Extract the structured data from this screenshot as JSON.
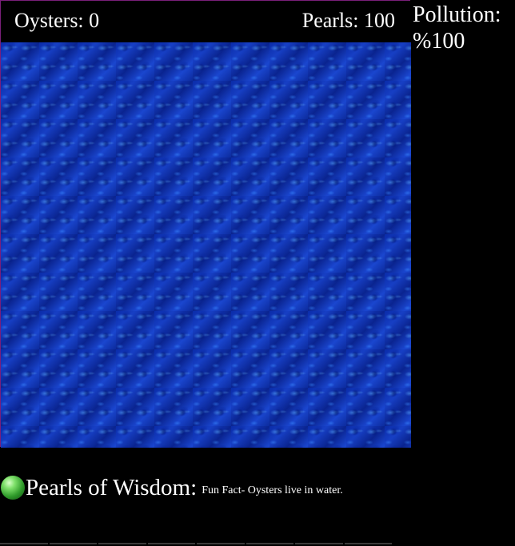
{
  "hud": {
    "oysters_text": "Oysters: 0",
    "pearls_text": "Pearls: 100"
  },
  "pollution": {
    "label": "Pollution:",
    "value": "%100"
  },
  "wisdom": {
    "icon": "pearl-icon",
    "title": "Pearls of Wisdom:",
    "fact": "Fun Fact- Oysters live in water."
  },
  "colors": {
    "background": "#000000",
    "water": "#0b2a9e",
    "frame_border": "#7a1f7a",
    "pearl": "#3fae35",
    "text": "#ffffff"
  }
}
